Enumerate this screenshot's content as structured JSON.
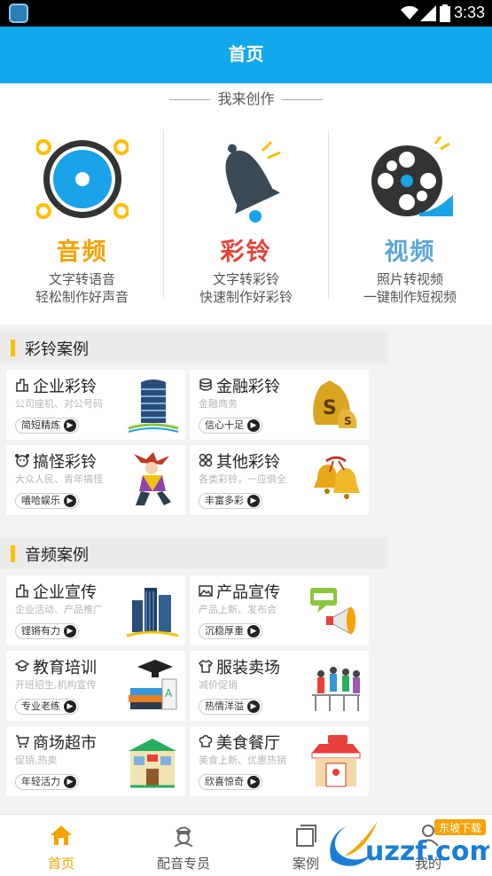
{
  "status_bar": {
    "time": "3:33"
  },
  "header": {
    "title": "首页"
  },
  "create": {
    "title": "我来创作",
    "items": [
      {
        "name": "音频",
        "desc1": "文字转语音",
        "desc2": "轻松制作好声音",
        "color": "#f5a300"
      },
      {
        "name": "彩铃",
        "desc1": "文字转彩铃",
        "desc2": "快速制作好彩铃",
        "color": "#e8403a"
      },
      {
        "name": "视频",
        "desc1": "照片转视频",
        "desc2": "一键制作短视频",
        "color": "#5aa7d8"
      }
    ]
  },
  "ringtone_section": {
    "title": "彩铃案例",
    "cards": [
      {
        "title": "企业彩铃",
        "sub": "公司座机、对公号码",
        "tag": "简短精炼"
      },
      {
        "title": "金融彩铃",
        "sub": "金融商务",
        "tag": "信心十足"
      },
      {
        "title": "搞怪彩铃",
        "sub": "大众人民、青年搞怪",
        "tag": "嘻哈娱乐"
      },
      {
        "title": "其他彩铃",
        "sub": "各类彩铃，一应俱全",
        "tag": "丰富多彩"
      }
    ]
  },
  "audio_section": {
    "title": "音频案例",
    "cards": [
      {
        "title": "企业宣传",
        "sub": "企业活动、产品推广",
        "tag": "铿锵有力"
      },
      {
        "title": "产品宣传",
        "sub": "产品上新、发布会",
        "tag": "沉稳厚重"
      },
      {
        "title": "教育培训",
        "sub": "开班招生,机构宣传",
        "tag": "专业老练"
      },
      {
        "title": "服装卖场",
        "sub": "减价促销",
        "tag": "热情洋溢"
      },
      {
        "title": "商场超市",
        "sub": "促销,热卖",
        "tag": "年轻活力"
      },
      {
        "title": "美食餐厅",
        "sub": "美食上新、优惠热销",
        "tag": "欣喜惊奇"
      }
    ]
  },
  "bottom_nav": {
    "items": [
      {
        "label": "首页",
        "icon": "home-icon",
        "active": true
      },
      {
        "label": "配音专员",
        "icon": "voice-actor-icon",
        "active": false
      },
      {
        "label": "案例",
        "icon": "cases-icon",
        "active": false
      },
      {
        "label": "我的",
        "icon": "profile-icon",
        "active": false
      }
    ]
  },
  "watermark": {
    "brand": "uzzf.com",
    "tagline": "东坡下载"
  },
  "colors": {
    "header_bg": "#12a8ec",
    "accent_yellow": "#ffc000",
    "nav_active": "#f5a300"
  }
}
